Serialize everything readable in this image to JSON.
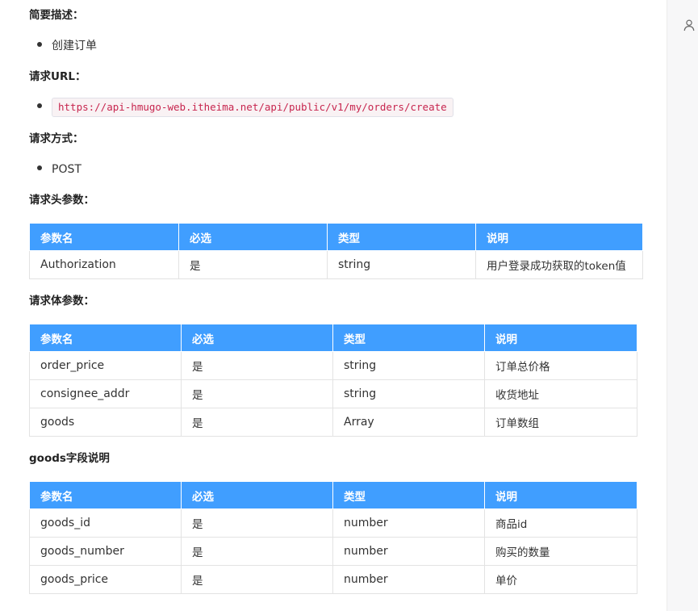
{
  "sections": {
    "description_title": "简要描述：",
    "description_items": [
      "创建订单"
    ],
    "url_title": "请求URL：",
    "url": "https://api-hmugo-web.itheima.net/api/public/v1/my/orders/create",
    "method_title": "请求方式：",
    "method": "POST",
    "header_params_title": "请求头参数：",
    "body_params_title": "请求体参数：",
    "goods_fields_title": "goods字段说明"
  },
  "header_table": {
    "columns": [
      "参数名",
      "必选",
      "类型",
      "说明"
    ],
    "rows": [
      [
        "Authorization",
        "是",
        "string",
        "用户登录成功获取的token值"
      ]
    ]
  },
  "body_table": {
    "columns": [
      "参数名",
      "必选",
      "类型",
      "说明"
    ],
    "rows": [
      [
        "order_price",
        "是",
        "string",
        "订单总价格"
      ],
      [
        "consignee_addr",
        "是",
        "string",
        "收货地址"
      ],
      [
        "goods",
        "是",
        "Array",
        "订单数组"
      ]
    ]
  },
  "goods_table": {
    "columns": [
      "参数名",
      "必选",
      "类型",
      "说明"
    ],
    "rows": [
      [
        "goods_id",
        "是",
        "number",
        "商品id"
      ],
      [
        "goods_number",
        "是",
        "number",
        "购买的数量"
      ],
      [
        "goods_price",
        "是",
        "number",
        "单价"
      ]
    ]
  },
  "right_rail": {
    "icon": "user-icon"
  },
  "colors": {
    "table_header_bg": "#409eff",
    "code_text": "#c7254e"
  }
}
